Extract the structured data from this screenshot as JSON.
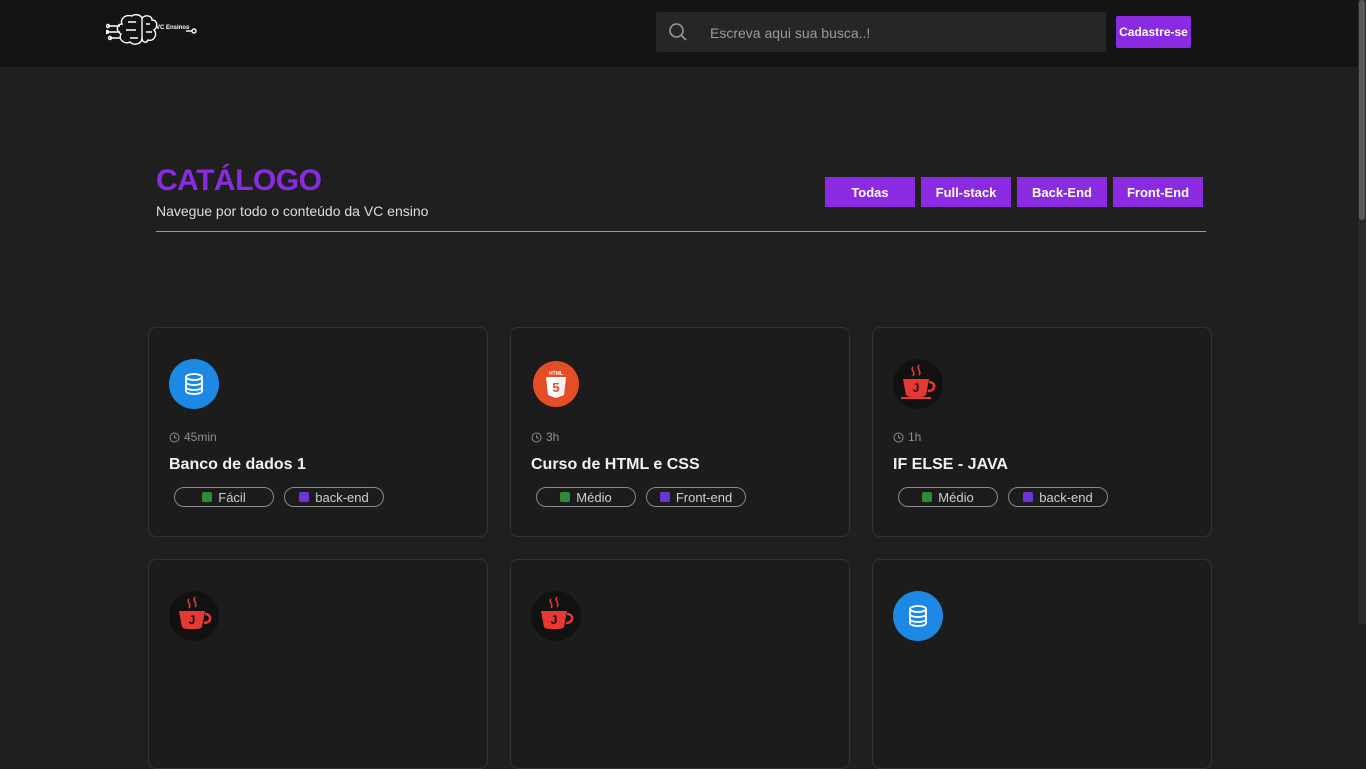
{
  "header": {
    "logo_text": "VC Ensinos",
    "search_placeholder": "Escreva aqui sua busca..!",
    "signup_label": "Cadastre-se"
  },
  "catalog": {
    "title": "CATÁLOGO",
    "subtitle": "Navegue por todo o conteúdo da VC ensino",
    "filters": [
      "Todas",
      "Full-stack",
      "Back-End",
      "Front-End"
    ]
  },
  "cards": [
    {
      "icon": "database-icon",
      "duration": "45min",
      "title": "Banco de dados 1",
      "level": "Fácil",
      "category": "back-end"
    },
    {
      "icon": "html5-icon",
      "duration": "3h",
      "title": "Curso de HTML e CSS",
      "level": "Médio",
      "category": "Front-end"
    },
    {
      "icon": "java-icon",
      "duration": "1h",
      "title": "IF ELSE - JAVA",
      "level": "Médio",
      "category": "back-end"
    },
    {
      "icon": "java-icon"
    },
    {
      "icon": "java-icon"
    },
    {
      "icon": "database-icon"
    }
  ],
  "colors": {
    "accent": "#8a2be2",
    "background": "#1f1f1f",
    "header": "#141414"
  }
}
